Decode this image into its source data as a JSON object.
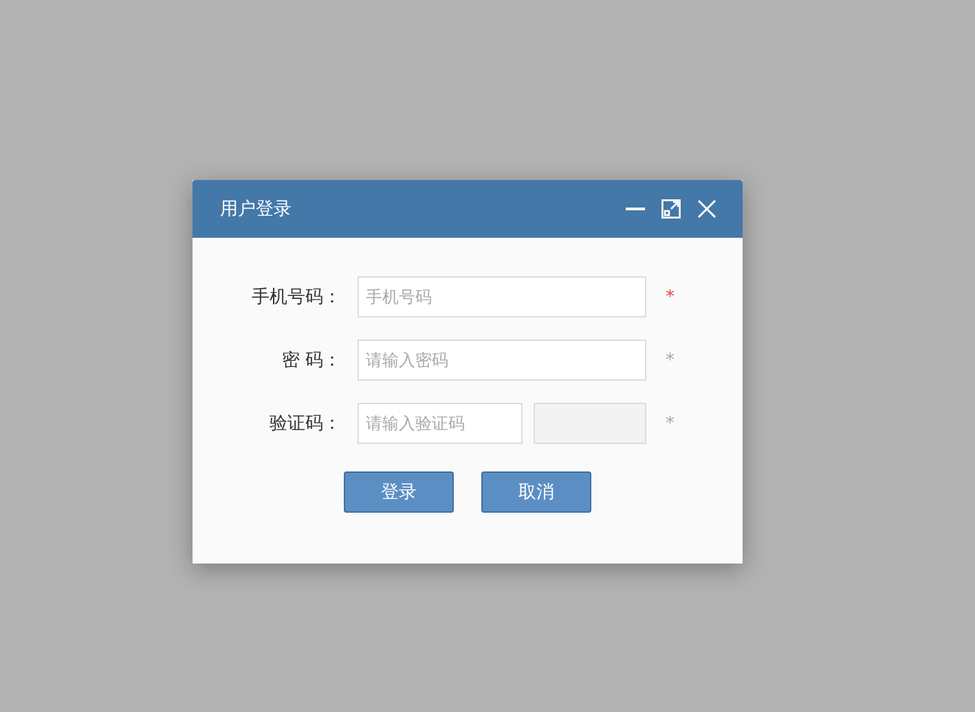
{
  "dialog": {
    "title": "用户登录"
  },
  "fields": [
    {
      "kind": "text",
      "label": "手机号码：",
      "placeholder": "手机号码",
      "required_mark": "*",
      "color": "#d9534f"
    },
    {
      "kind": "password",
      "label": "密 码：",
      "placeholder": "请输入密码",
      "required_mark": "*",
      "color": "#aaaaaa"
    },
    {
      "kind": "captcha",
      "label": "验证码：",
      "placeholder": "请输入验证码",
      "required_mark": "*",
      "color": "#aaaaaa"
    }
  ],
  "buttons": [
    "登录",
    "取消"
  ]
}
